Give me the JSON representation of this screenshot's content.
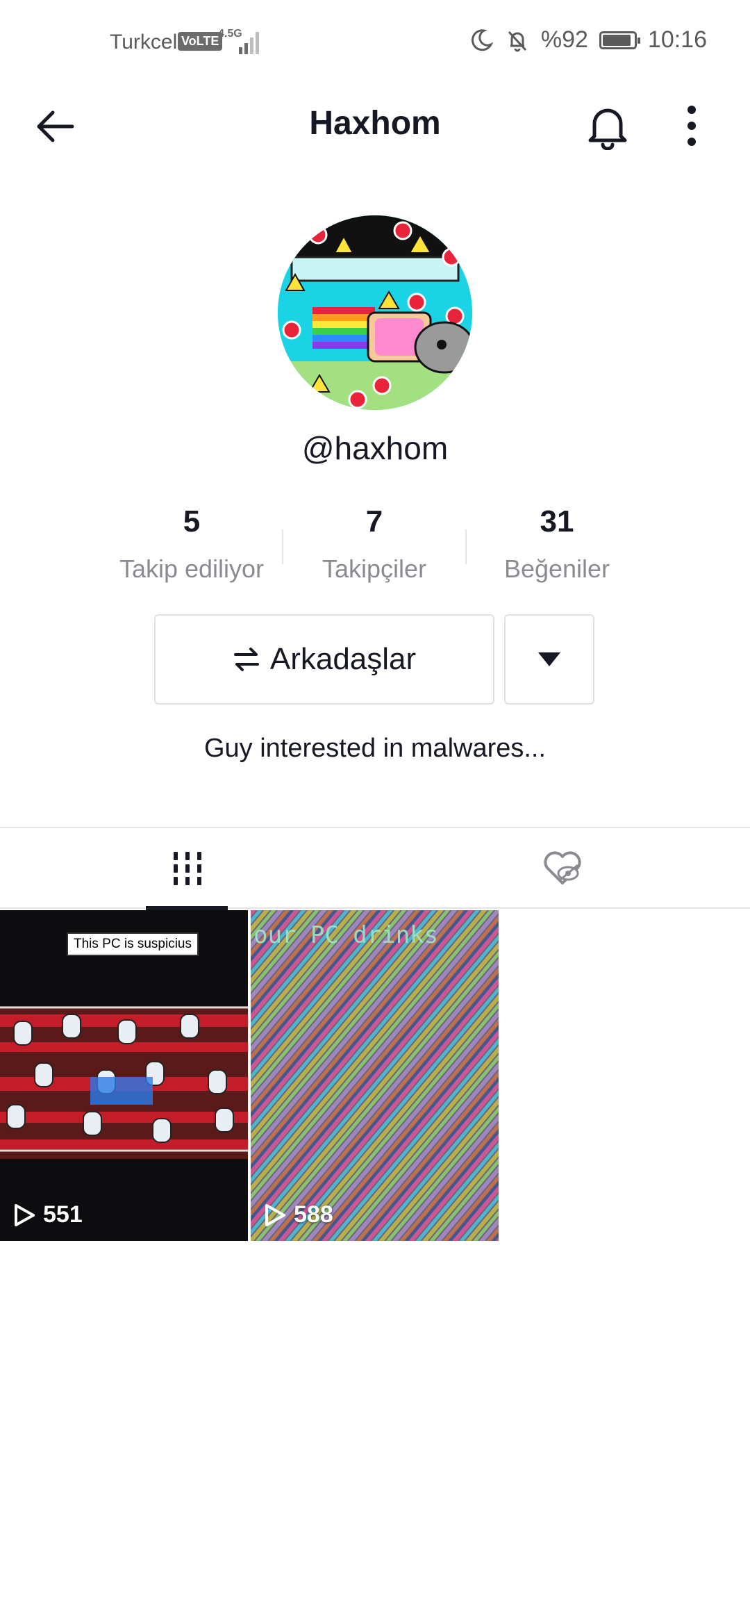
{
  "status_bar": {
    "carrier": "Turkcell",
    "volte": "VoLTE",
    "network": "4.5G",
    "battery": "%92",
    "time": "10:16",
    "battery_level": 0.92
  },
  "header": {
    "title": "Haxhom",
    "back_icon": "arrow-left-icon",
    "bell_icon": "bell-icon",
    "more_icon": "more-vertical-icon"
  },
  "profile": {
    "handle": "@haxhom",
    "stats": [
      {
        "value": "5",
        "label": "Takip ediliyor"
      },
      {
        "value": "7",
        "label": "Takipçiler"
      },
      {
        "value": "31",
        "label": "Beğeniler"
      }
    ],
    "friends_button": "Arkadaşlar",
    "bio": "Guy interested in malwares..."
  },
  "tabs": [
    {
      "icon": "videos-grid-icon",
      "active": true
    },
    {
      "icon": "liked-hidden-icon",
      "active": false
    }
  ],
  "videos": [
    {
      "views": "551",
      "caption": "This PC is suspicius"
    },
    {
      "views": "588",
      "caption": "our PC drinks"
    }
  ]
}
